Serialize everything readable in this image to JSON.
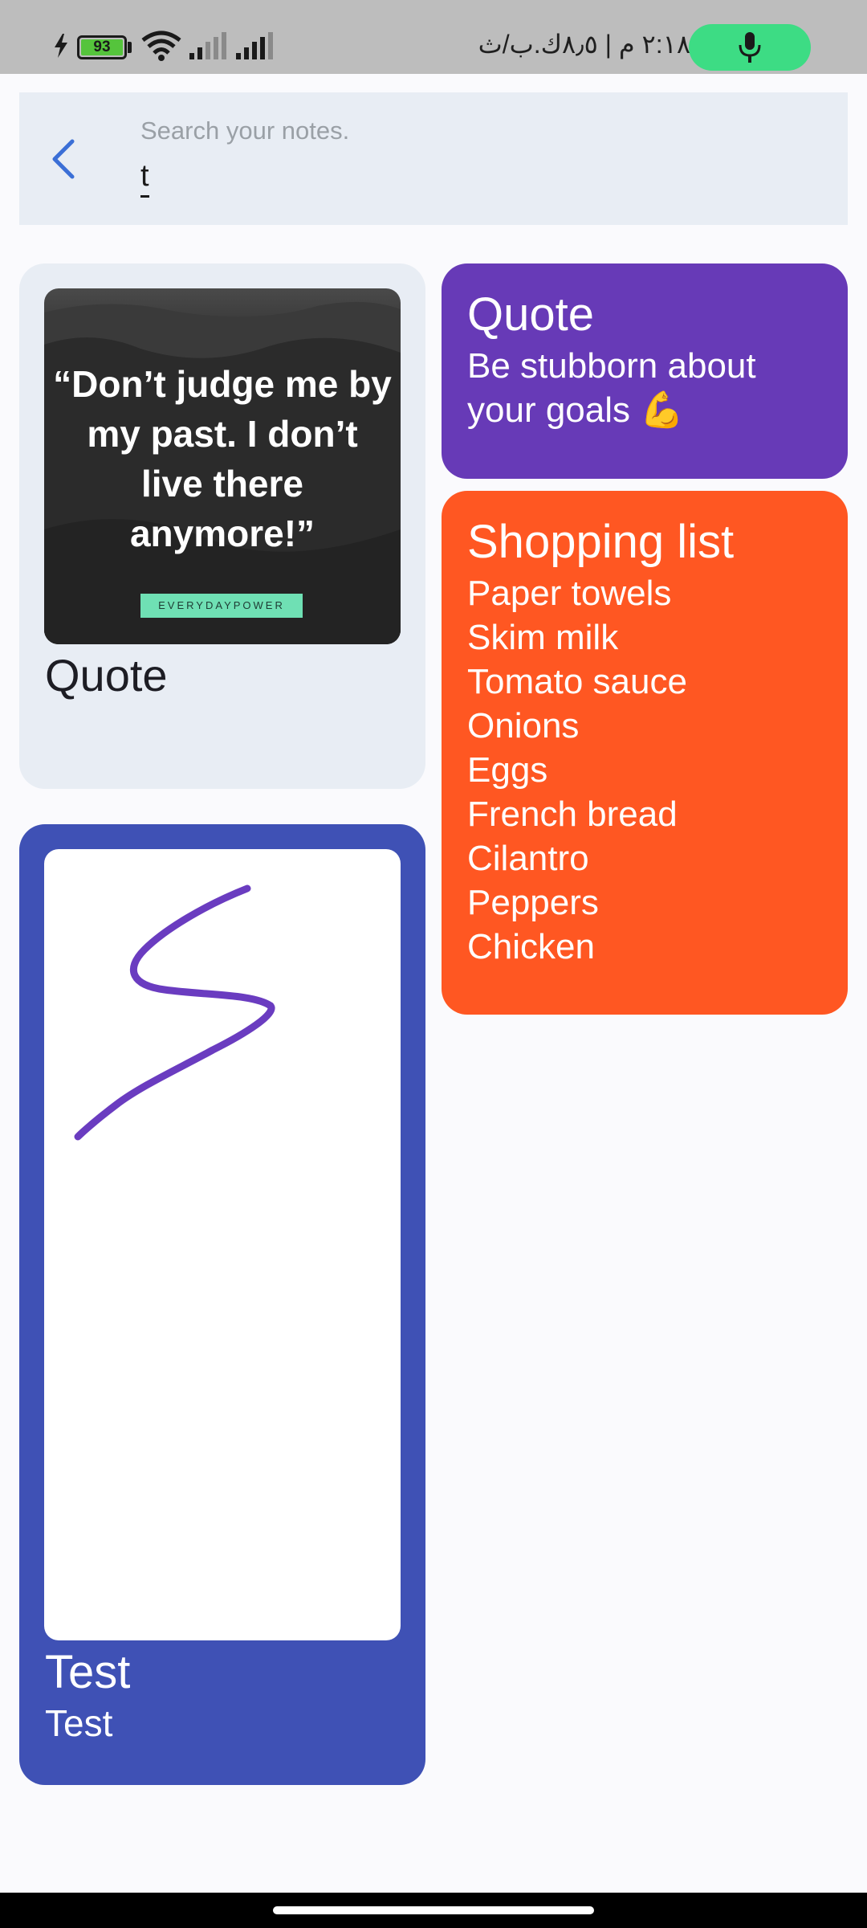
{
  "status_bar": {
    "battery_level": "93",
    "clock_text": "٢:١٨ م | ٨٫٥ك.ب/ث",
    "icons": [
      "bolt-icon",
      "battery-icon",
      "wifi-icon",
      "signal-icon",
      "signal-icon",
      "mic-icon"
    ],
    "mic_pill_color": "#3ddc84"
  },
  "search": {
    "placeholder": "Search your notes.",
    "value": "t",
    "back_icon": "chevron-left-icon",
    "accent": "#3b6fd6"
  },
  "notes": [
    {
      "title": "Quote",
      "image_text": "“Don’t judge me by my past. I don’t live there anymore!”",
      "image_brand": "EVERYDAYPOWER",
      "color": "#e8edf4"
    },
    {
      "title": "Quote",
      "body": "Be stubborn about your goals 💪",
      "color": "#673ab7"
    },
    {
      "title": "Shopping list",
      "items": [
        "Paper towels",
        "Skim milk",
        "Tomato sauce",
        "Onions",
        "Eggs",
        "French bread",
        "Cilantro",
        "Peppers",
        "Chicken"
      ],
      "color": "#ff5722"
    },
    {
      "title": "Test",
      "body": "Test",
      "drawing_stroke_color": "#6a3cc0",
      "color": "#3f51b5"
    }
  ]
}
